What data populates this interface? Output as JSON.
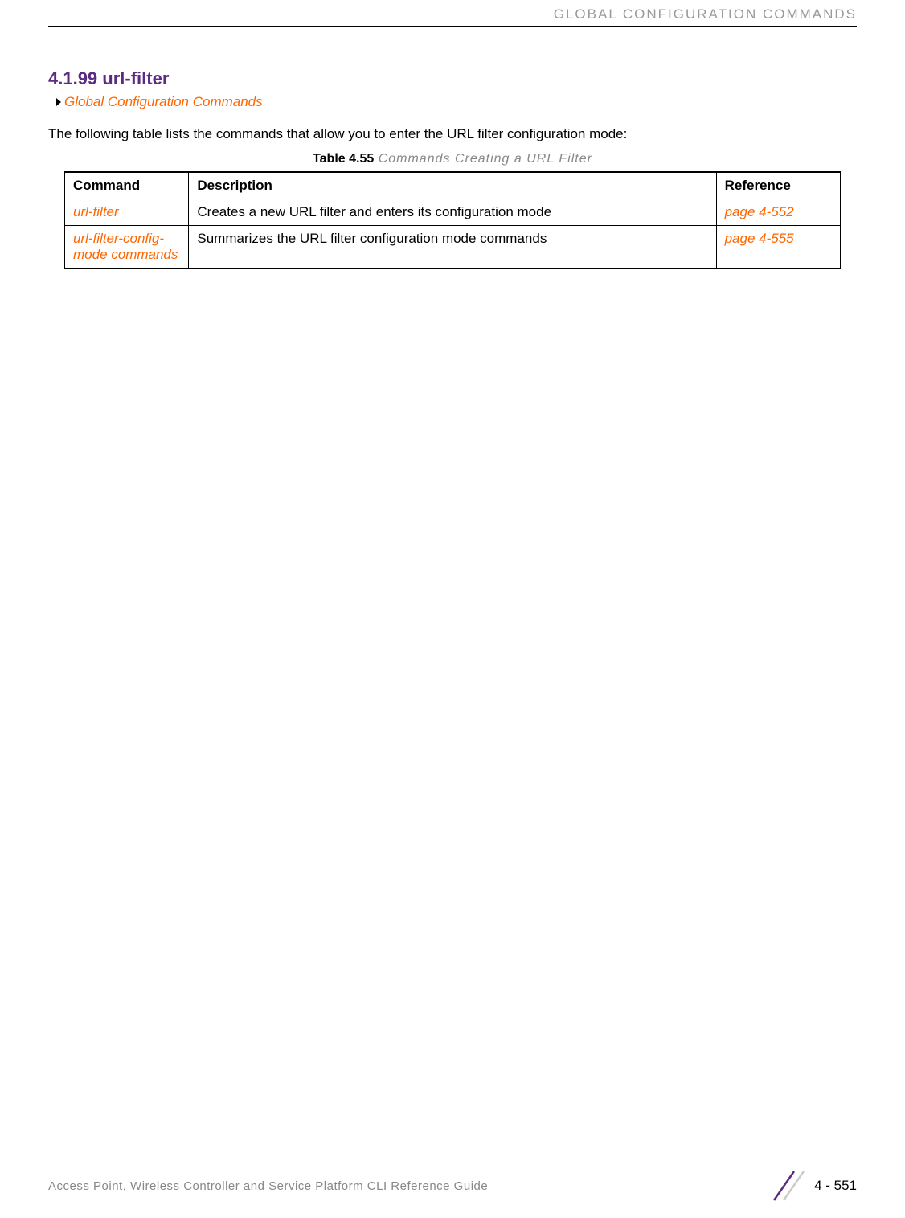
{
  "header": {
    "right_text": "GLOBAL CONFIGURATION COMMANDS"
  },
  "section": {
    "heading": "4.1.99 url-filter",
    "breadcrumb": "Global Configuration Commands",
    "intro": "The following table lists the commands that allow you to enter the URL filter configuration mode:"
  },
  "table": {
    "caption_bold": "Table 4.55",
    "caption_italic": " Commands Creating a URL Filter",
    "headers": {
      "command": "Command",
      "description": "Description",
      "reference": "Reference"
    },
    "rows": [
      {
        "command": "url-filter",
        "description": "Creates a new URL filter and enters its configuration mode",
        "reference": "page 4-552"
      },
      {
        "command": "url-filter-config-mode commands",
        "description": "Summarizes the URL filter configuration mode commands",
        "reference": "page 4-555"
      }
    ]
  },
  "footer": {
    "left_text": "Access Point, Wireless Controller and Service Platform CLI Reference Guide",
    "page_number": "4 - 551"
  }
}
